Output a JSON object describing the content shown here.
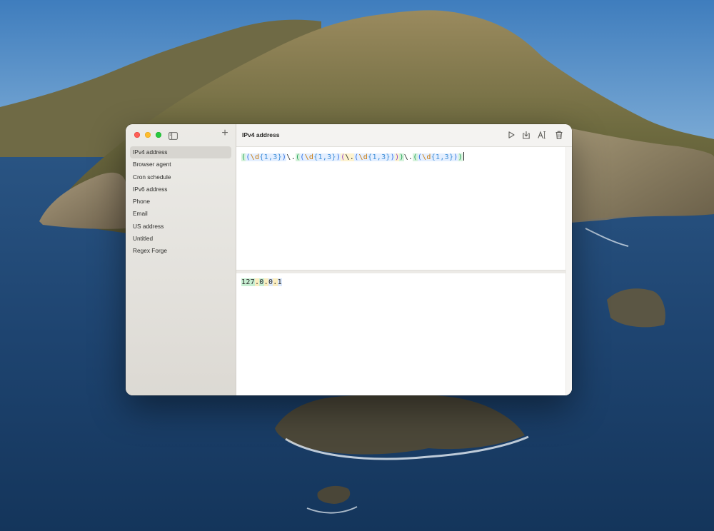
{
  "window": {
    "title": "IPv4 address"
  },
  "sidebar": {
    "items": [
      {
        "label": "IPv4 address",
        "selected": true
      },
      {
        "label": "Browser agent"
      },
      {
        "label": "Cron schedule"
      },
      {
        "label": "IPv6 address"
      },
      {
        "label": "Phone"
      },
      {
        "label": "Email"
      },
      {
        "label": "US address"
      },
      {
        "label": "Untitled"
      },
      {
        "label": "Regex Forge"
      }
    ],
    "add_label": "+"
  },
  "toolbar": {
    "icons": [
      "play-icon",
      "export-icon",
      "text-format-icon",
      "trash-icon"
    ]
  },
  "editor": {
    "pattern_tokens": [
      {
        "t": "(",
        "c": "p-green",
        "hl": "g1"
      },
      {
        "t": "(",
        "c": "p-blue",
        "hl": "g2"
      },
      {
        "t": "\\d",
        "c": "esc",
        "hl": "g2"
      },
      {
        "t": "{1,3}",
        "c": "quant",
        "hl": "g2"
      },
      {
        "t": ")",
        "c": "p-blue",
        "hl": "g2"
      },
      {
        "t": "\\.",
        "c": "literal",
        "hl": ""
      },
      {
        "t": "(",
        "c": "p-green",
        "hl": "g1"
      },
      {
        "t": "(",
        "c": "p-blue",
        "hl": "g2"
      },
      {
        "t": "\\d",
        "c": "esc",
        "hl": "g2"
      },
      {
        "t": "{1,3}",
        "c": "quant",
        "hl": "g2"
      },
      {
        "t": ")",
        "c": "p-blue",
        "hl": "g2"
      },
      {
        "t": "(",
        "c": "p-purple",
        "hl": "g3"
      },
      {
        "t": "\\.",
        "c": "literal",
        "hl": "g3"
      },
      {
        "t": "(",
        "c": "p-blue",
        "hl": "g2"
      },
      {
        "t": "\\d",
        "c": "esc",
        "hl": "g2"
      },
      {
        "t": "{1,3}",
        "c": "quant",
        "hl": "g2"
      },
      {
        "t": ")",
        "c": "p-blue",
        "hl": "g2"
      },
      {
        "t": ")",
        "c": "p-purple",
        "hl": "g3"
      },
      {
        "t": ")",
        "c": "p-green",
        "hl": "g1"
      },
      {
        "t": "\\.",
        "c": "literal",
        "hl": ""
      },
      {
        "t": "(",
        "c": "p-green",
        "hl": "g1"
      },
      {
        "t": "(",
        "c": "p-blue",
        "hl": "g2"
      },
      {
        "t": "\\d",
        "c": "esc",
        "hl": "g2"
      },
      {
        "t": "{1,3}",
        "c": "quant",
        "hl": "g2"
      },
      {
        "t": ")",
        "c": "p-blue",
        "hl": "g2"
      },
      {
        "t": ")",
        "c": "p-green",
        "hl": "g1"
      }
    ],
    "test_string": "127.0.0.1",
    "test_segments": [
      {
        "t": "127",
        "hl": "m1"
      },
      {
        "t": ".",
        "hl": "m2"
      },
      {
        "t": "0",
        "hl": "m1"
      },
      {
        "t": ".",
        "hl": "m2"
      },
      {
        "t": "0",
        "hl": "m3"
      },
      {
        "t": ".",
        "hl": "m2"
      },
      {
        "t": "1",
        "hl": "m3"
      }
    ]
  },
  "colors": {
    "close": "#fe5f57",
    "minimize": "#febc2e",
    "zoom": "#28c840",
    "selection": "#d7d5d0"
  }
}
